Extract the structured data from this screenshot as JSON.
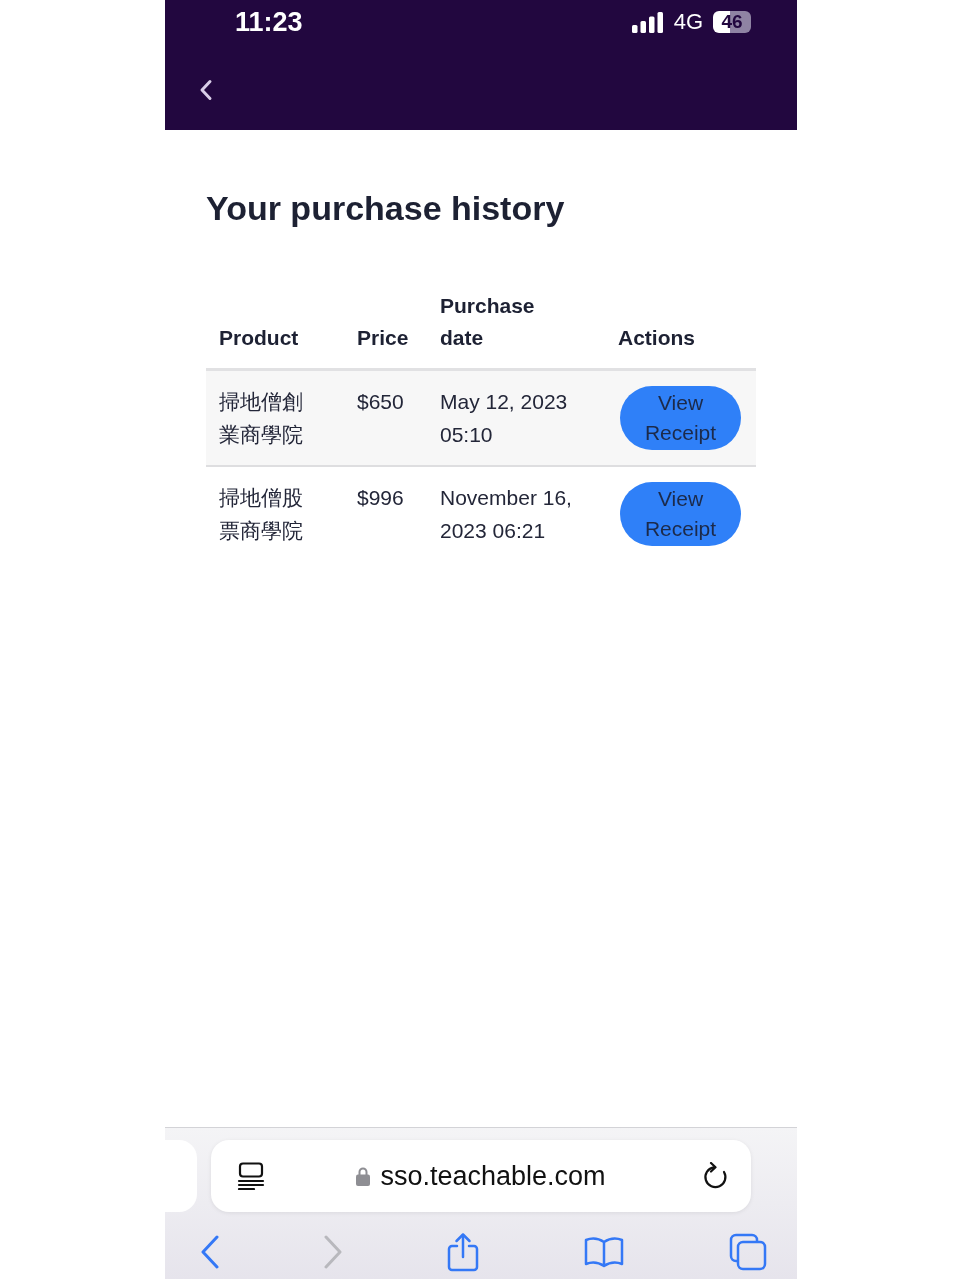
{
  "status_bar": {
    "time": "11:23",
    "network": "4G",
    "battery": "46"
  },
  "page": {
    "title": "Your purchase history"
  },
  "table": {
    "columns": [
      "Product",
      "Price",
      "Purchase date",
      "Actions"
    ],
    "rows": [
      {
        "product": "掃地僧創業商學院",
        "price": "$650",
        "purchase_date": "May 12, 2023 05:10",
        "action": "View Receipt"
      },
      {
        "product": "掃地僧股票商學院",
        "price": "$996",
        "purchase_date": "November 16, 2023 06:21",
        "action": "View Receipt"
      }
    ]
  },
  "browser": {
    "url": "sso.teachable.com",
    "toolbar": [
      {
        "kind": "back",
        "disabled": false
      },
      {
        "kind": "forward",
        "disabled": true
      },
      {
        "kind": "share",
        "disabled": false
      },
      {
        "kind": "bookmarks",
        "disabled": false
      },
      {
        "kind": "tabs",
        "disabled": false
      }
    ]
  }
}
